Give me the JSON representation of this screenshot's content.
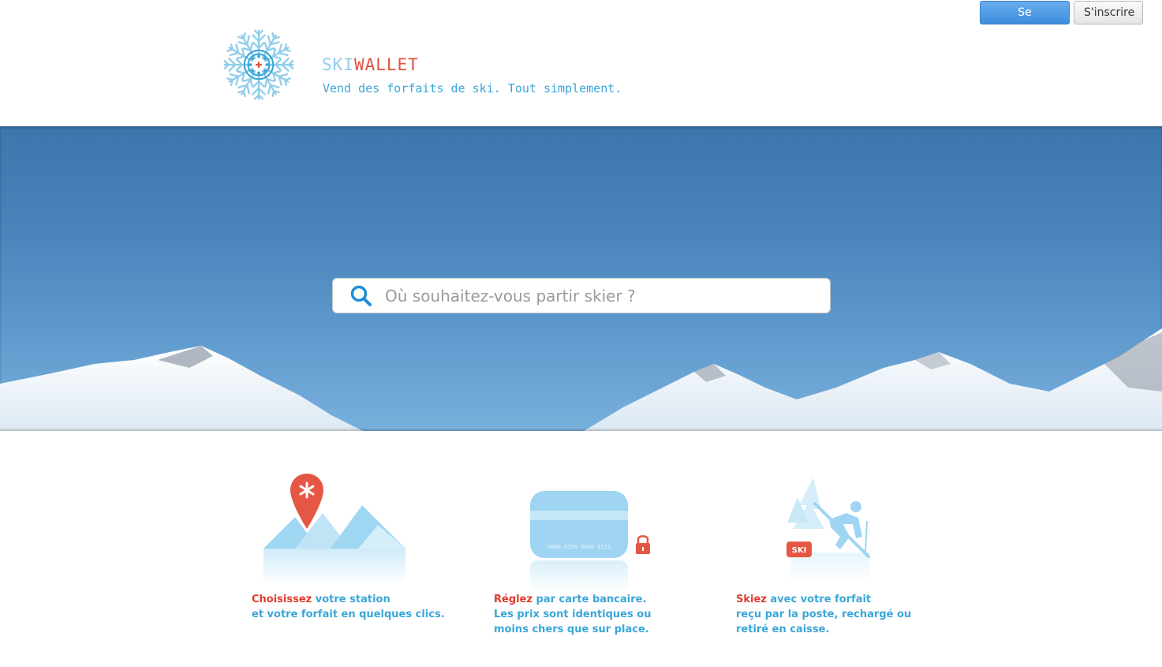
{
  "header": {
    "login_label": "Se connecter",
    "signup_label": "S'inscrire",
    "brand_ski": "SKI",
    "brand_wallet": "WALLET",
    "tagline": "Vend des forfaits de ski. Tout simplement."
  },
  "search": {
    "placeholder": "Où souhaitez-vous partir skier ?"
  },
  "features": [
    {
      "highlight": "Choisissez",
      "line1": " votre station",
      "line2": "et votre forfait en quelques clics.",
      "line3": ""
    },
    {
      "highlight": "Réglez",
      "line1": " par carte bancaire.",
      "line2": "Les prix sont identiques ou",
      "line3": "moins chers que sur place."
    },
    {
      "highlight": "Skiez",
      "line1": " avec votre forfait",
      "line2": "reçu par la poste, rechargé ou",
      "line3": "retiré en caisse."
    }
  ],
  "icons": {
    "card_number": "0000 0150 0000 0111",
    "ski_badge": "SKI"
  },
  "colors": {
    "accent_blue": "#3aa6d8",
    "accent_red": "#e13a2a",
    "light_blue": "#8fcdea",
    "button_blue": "#3d8ddc"
  }
}
